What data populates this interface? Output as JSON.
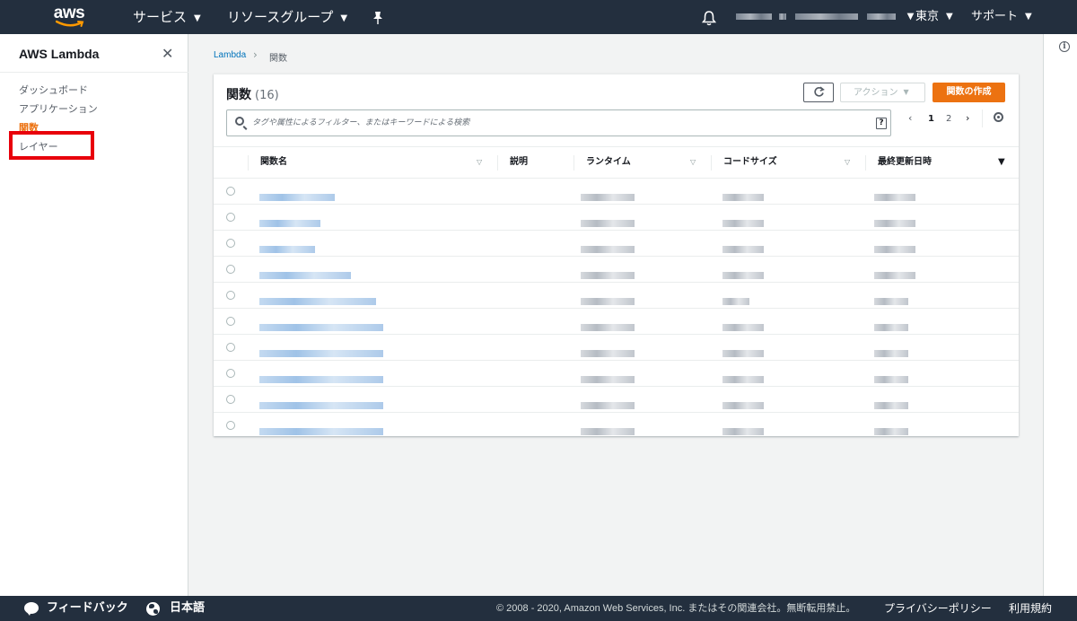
{
  "topnav": {
    "logo": "aws",
    "services": "サービス",
    "resource_groups": "リソースグループ",
    "pin_icon": "pin-icon",
    "bell_icon": "bell-icon",
    "region": "東京",
    "support": "サポート"
  },
  "sidebar": {
    "title": "AWS Lambda",
    "items": [
      {
        "label": "ダッシュボード",
        "active": false
      },
      {
        "label": "アプリケーション",
        "active": false
      },
      {
        "label": "関数",
        "active": true
      },
      {
        "label": "レイヤー",
        "active": false
      }
    ],
    "highlight_color": "#e8000b"
  },
  "breadcrumb": {
    "root": "Lambda",
    "current": "関数"
  },
  "panel": {
    "title": "関数",
    "count": "(16)",
    "action_label": "アクション",
    "create_label": "関数の作成",
    "search_placeholder": "タグや属性によるフィルター、またはキーワードによる検索",
    "help": "?",
    "pages": [
      "1",
      "2"
    ],
    "current_page": "1"
  },
  "table": {
    "columns": [
      "関数名",
      "説明",
      "ランタイム",
      "コードサイズ",
      "最終更新日時"
    ],
    "sorted_column": "最終更新日時",
    "row_count_visible": 10
  },
  "footer": {
    "feedback": "フィードバック",
    "language": "日本語",
    "copyright": "© 2008 - 2020, Amazon Web Services, Inc. またはその関連会社。無断転用禁止。",
    "privacy": "プライバシーポリシー",
    "terms": "利用規約"
  },
  "colors": {
    "nav_bg": "#232f3e",
    "accent": "#ec7211",
    "link": "#0073bb"
  }
}
